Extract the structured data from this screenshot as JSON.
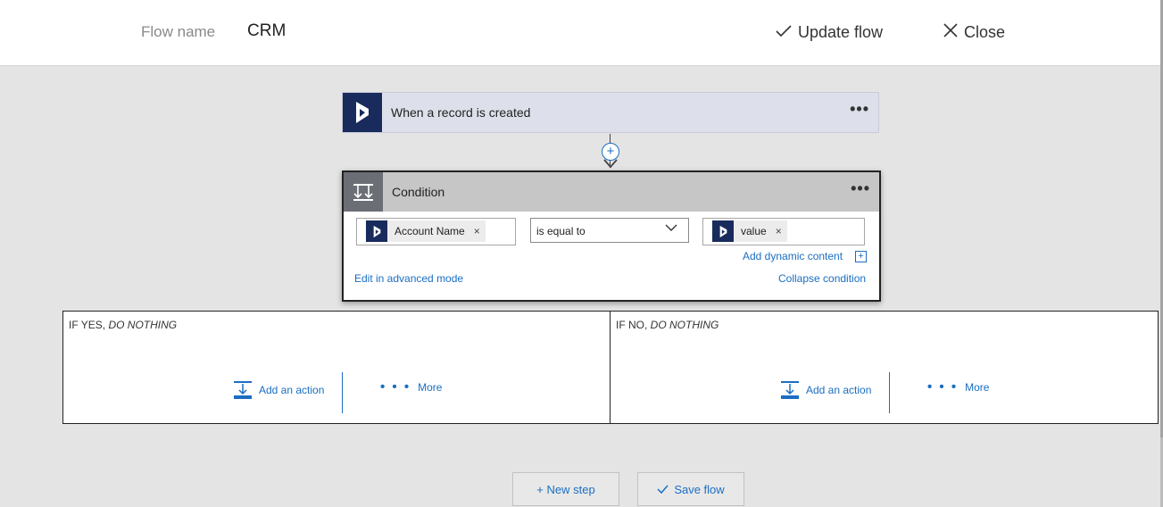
{
  "header": {
    "flow_name_label": "Flow name",
    "flow_name_value": "CRM",
    "update_label": "Update flow",
    "close_label": "Close"
  },
  "trigger": {
    "title": "When a record is created",
    "menu": "•••"
  },
  "condition": {
    "title": "Condition",
    "menu": "•••",
    "left_token": "Account Name",
    "operator": "is equal to",
    "right_token": "value",
    "token_remove": "×",
    "add_dynamic": "Add dynamic content",
    "add_dynamic_icon": "+",
    "edit_advanced": "Edit in advanced mode",
    "collapse": "Collapse condition"
  },
  "branches": {
    "yes_prefix": "IF YES, ",
    "yes_suffix": "DO NOTHING",
    "no_prefix": "IF NO, ",
    "no_suffix": "DO NOTHING",
    "add_action": "Add an action",
    "more_dots": "• • •",
    "more": "More"
  },
  "footer": {
    "new_step": "+ New step",
    "save_flow": "Save flow"
  },
  "colors": {
    "accent": "#1b6ec2",
    "dynamics_bg": "#182b5c",
    "condition_bg": "#6b6e75"
  }
}
